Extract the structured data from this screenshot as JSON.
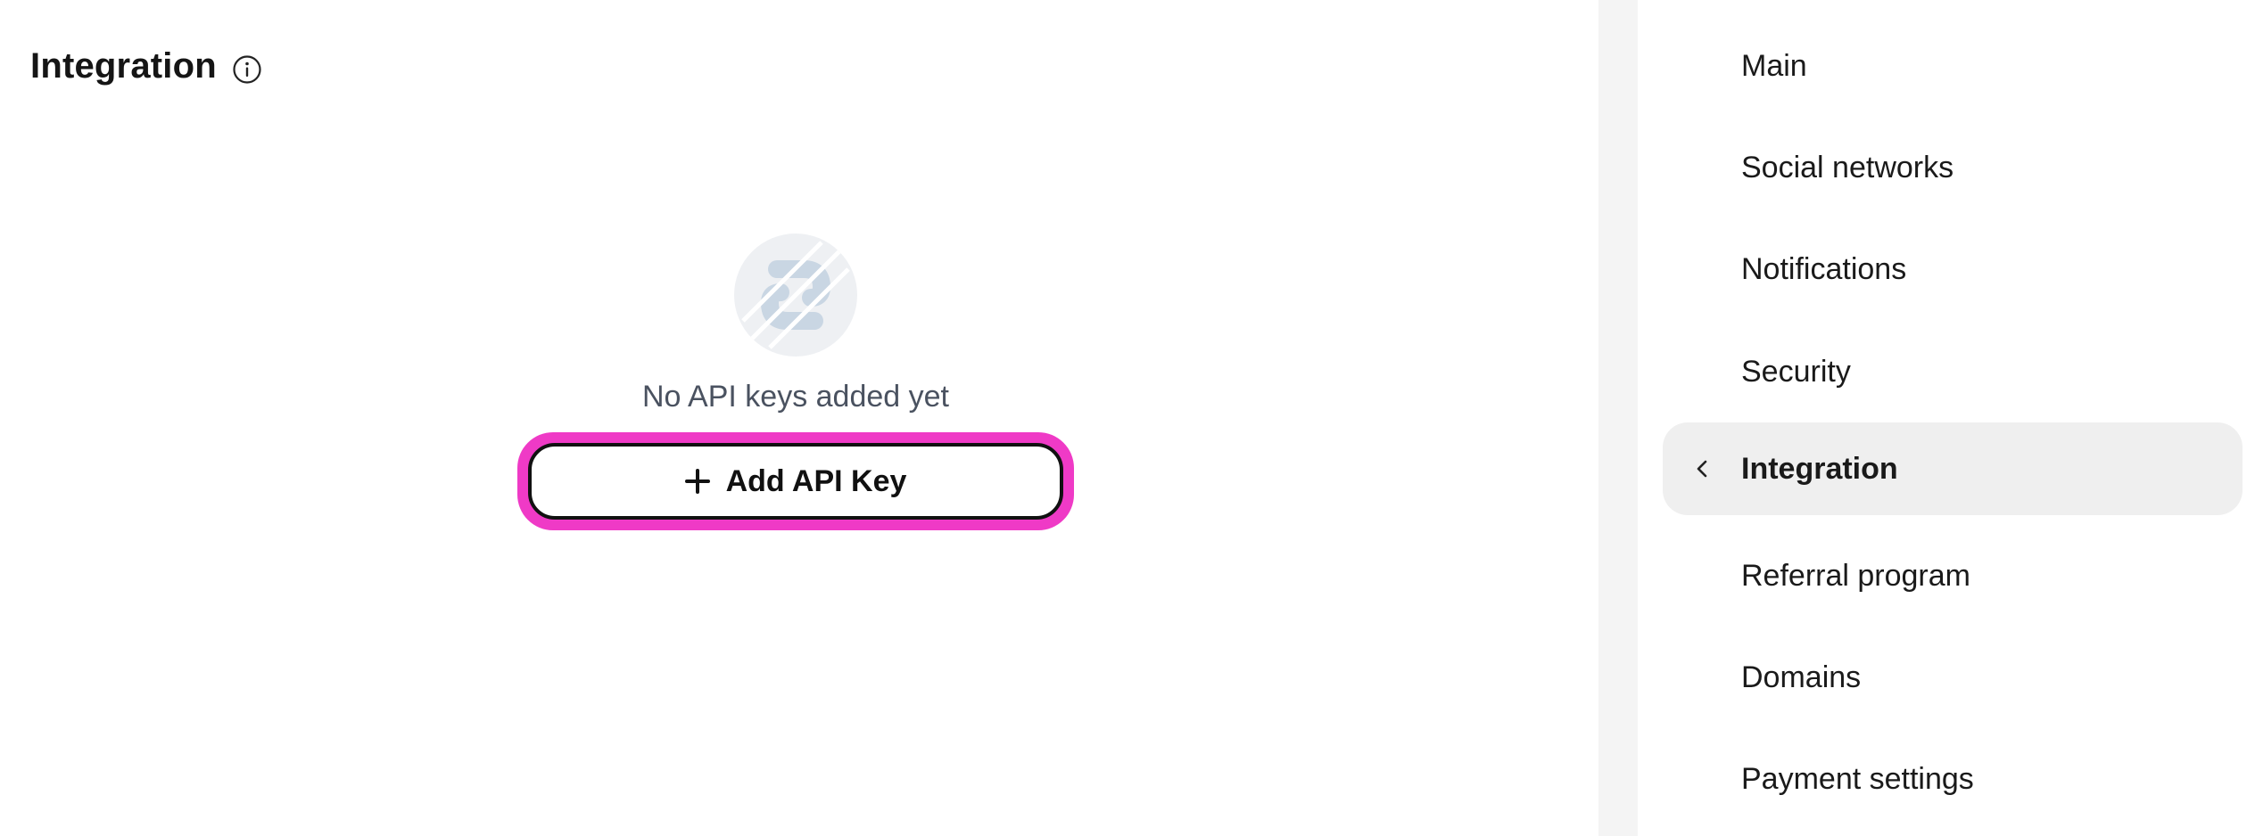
{
  "main": {
    "title": "Integration",
    "info_icon": "info-circle-icon",
    "empty_state": {
      "illustration_icon": "chain-link-icon",
      "message": "No API keys added yet",
      "button_label": "Add API Key",
      "button_icon": "plus-icon"
    }
  },
  "sidebar": {
    "items": [
      {
        "label": "Main",
        "active": false
      },
      {
        "label": "Social networks",
        "active": false
      },
      {
        "label": "Notifications",
        "active": false
      },
      {
        "label": "Security",
        "active": false
      },
      {
        "label": "Integration",
        "active": true
      },
      {
        "label": "Referral program",
        "active": false
      },
      {
        "label": "Domains",
        "active": false
      },
      {
        "label": "Payment settings",
        "active": false
      }
    ],
    "active_indicator_icon": "chevron-left-icon"
  },
  "colors": {
    "highlight_outline": "#ef3ac6",
    "active_item_bg": "#efefef",
    "page_bg": "#f4f4f4"
  }
}
